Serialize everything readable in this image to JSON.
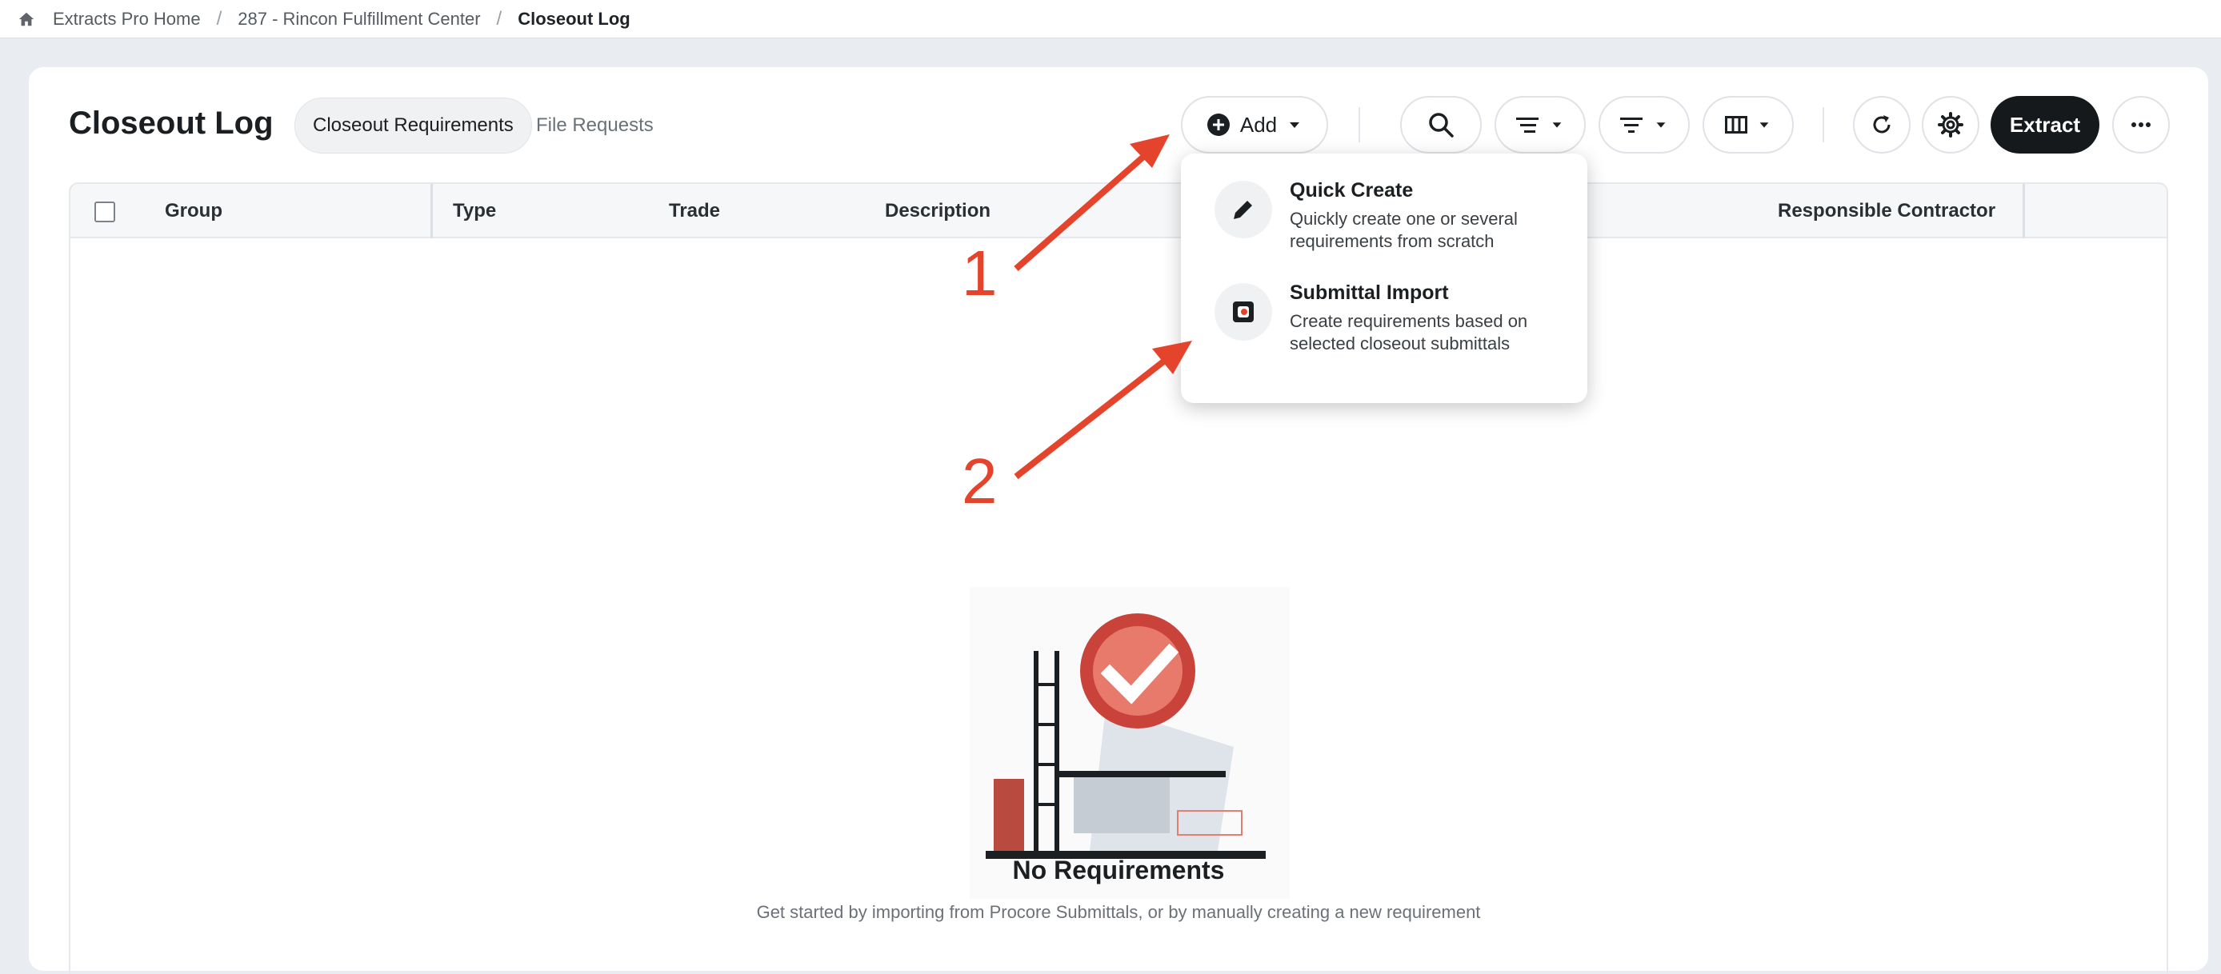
{
  "breadcrumb": {
    "home": "Extracts Pro Home",
    "project": "287 - Rincon Fulfillment Center",
    "current": "Closeout Log"
  },
  "header": {
    "title": "Closeout Log",
    "tabs": [
      "Closeout Requirements",
      "File Requests"
    ],
    "add_label": "Add",
    "extract_label": "Extract"
  },
  "table": {
    "columns": [
      "Group",
      "Type",
      "Trade",
      "Description",
      "Responsible Contractor"
    ]
  },
  "add_menu": {
    "items": [
      {
        "title": "Quick Create",
        "description": "Quickly create one or several requirements from scratch",
        "icon": "pencil-icon"
      },
      {
        "title": "Submittal Import",
        "description": "Create requirements based on selected closeout submittals",
        "icon": "procore-logo-icon"
      }
    ]
  },
  "empty_state": {
    "title": "No Requirements",
    "subtitle": "Get started by importing from Procore Submittals, or by manually creating a new requirement"
  },
  "annotations": [
    "1",
    "2"
  ],
  "colors": {
    "accent": "#e4432c",
    "dark_button": "#16191c"
  }
}
